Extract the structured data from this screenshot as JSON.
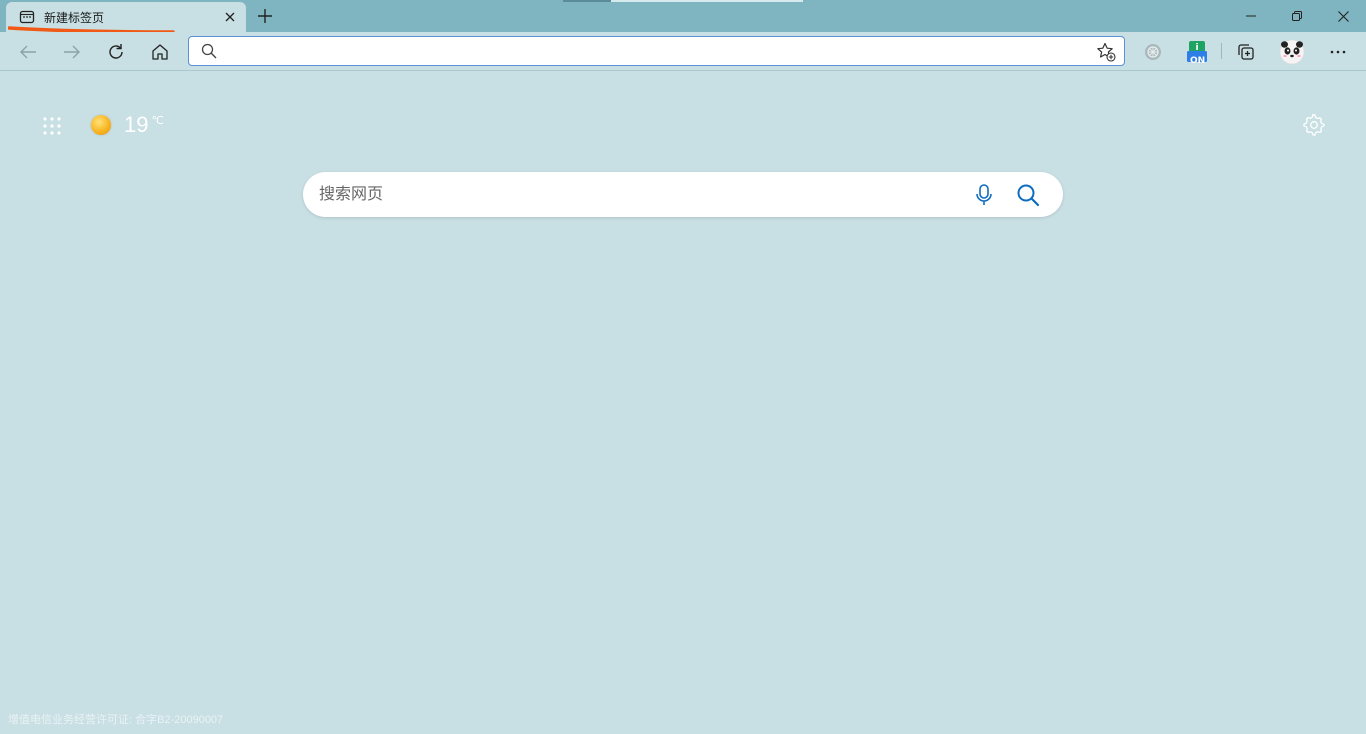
{
  "tab": {
    "title": "新建标签页"
  },
  "omnibox": {
    "value": "",
    "placeholder": ""
  },
  "extensions": {
    "badge_label": "ON"
  },
  "ntp": {
    "weather": {
      "temperature": "19",
      "unit": "℃",
      "condition_icon": "sun-icon"
    },
    "search": {
      "placeholder": "搜索网页"
    },
    "license_text": "增值电信业务经营许可证: 合字B2-20090007"
  },
  "colors": {
    "tab_strip": "#7fb5c0",
    "page_background": "#c8dfe3",
    "accent": "#0f6cbd",
    "annotation_underline": "#f05a16"
  }
}
